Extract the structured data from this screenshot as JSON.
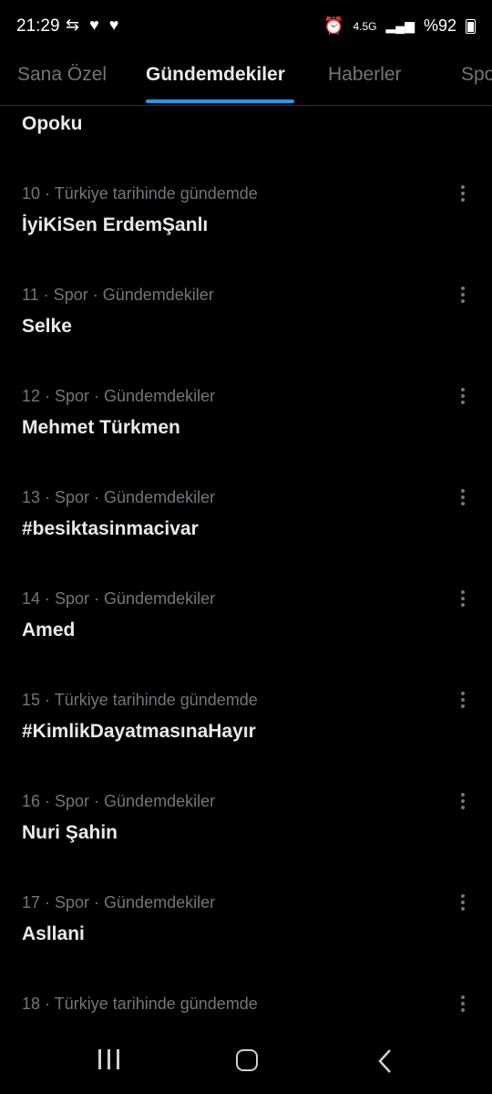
{
  "status_bar": {
    "time": "21:29",
    "left_icons": "⇆ ♥ ♥",
    "network": "4.5G",
    "battery": "%92"
  },
  "tabs": [
    {
      "label": "Sana Özel"
    },
    {
      "label": "Gündemdekiler"
    },
    {
      "label": "Haberler"
    },
    {
      "label": "Spo"
    }
  ],
  "active_tab": "Gündemdekiler",
  "feed": {
    "top_partial_title": "Opoku",
    "trends": [
      {
        "meta": "10 · Türkiye tarihinde gündemde",
        "title": "İyiKiSen ErdemŞanlı"
      },
      {
        "meta": "11 · Spor · Gündemdekiler",
        "title": "Selke"
      },
      {
        "meta": "12 · Spor · Gündemdekiler",
        "title": "Mehmet Türkmen"
      },
      {
        "meta": "13 · Spor · Gündemdekiler",
        "title": "#besiktasinmacivar"
      },
      {
        "meta": "14 · Spor · Gündemdekiler",
        "title": "Amed"
      },
      {
        "meta": "15 · Türkiye tarihinde gündemde",
        "title": "#KimlikDayatmasınaHayır"
      },
      {
        "meta": "16 · Spor · Gündemdekiler",
        "title": "Nuri Şahin"
      },
      {
        "meta": "17 · Spor · Gündemdekiler",
        "title": "Asllani"
      },
      {
        "meta": "18 · Türkiye tarihinde gündemde",
        "title": ""
      }
    ]
  },
  "colors": {
    "background": "#000000",
    "primary_text": "#e7e9ea",
    "secondary_text": "#71767b",
    "accent": "#1d9bf0"
  }
}
